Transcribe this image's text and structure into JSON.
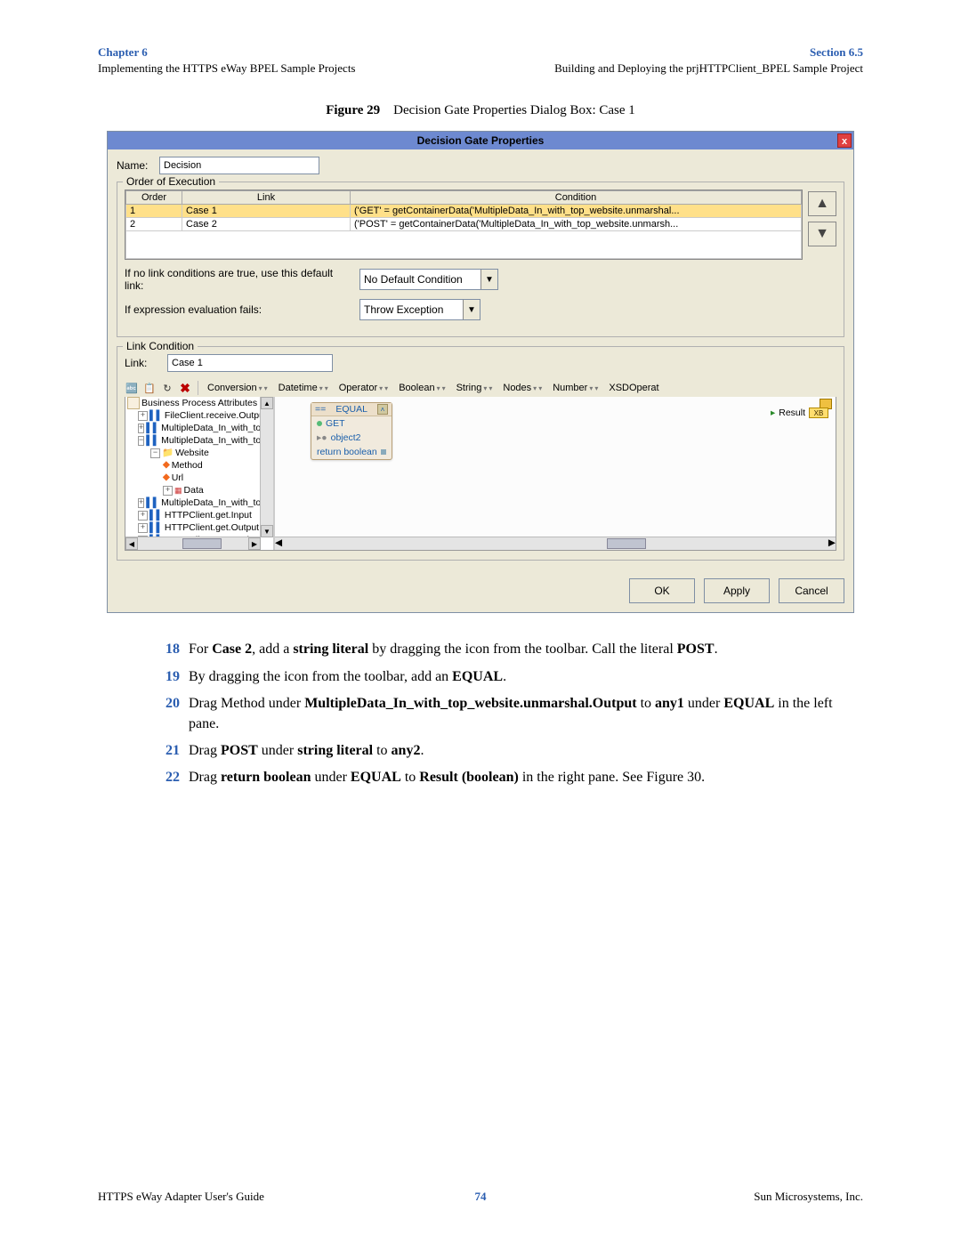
{
  "header": {
    "chapter": "Chapter 6",
    "left_sub": "Implementing the HTTPS eWay BPEL Sample Projects",
    "section": "Section 6.5",
    "right_sub": "Building and Deploying the prjHTTPClient_BPEL Sample Project"
  },
  "caption": {
    "fig": "Figure 29",
    "text": "Decision Gate Properties Dialog Box: Case 1"
  },
  "dialog": {
    "title": "Decision Gate Properties",
    "name_label": "Name:",
    "name_value": "Decision",
    "order_group": "Order of Execution",
    "cols": {
      "order": "Order",
      "link": "Link",
      "condition": "Condition"
    },
    "rows": [
      {
        "order": "1",
        "link": "Case 1",
        "condition": "('GET' = getContainerData('MultipleData_In_with_top_website.unmarshal..."
      },
      {
        "order": "2",
        "link": "Case 2",
        "condition": "('POST' = getContainerData('MultipleData_In_with_top_website.unmarsh..."
      }
    ],
    "default_link_label": "If no link conditions are true, use this default link:",
    "default_link_value": "No Default Condition",
    "fail_label": "If expression evaluation fails:",
    "fail_value": "Throw Exception",
    "link_cond_group": "Link Condition",
    "link_label": "Link:",
    "link_value": "Case 1",
    "toolbar": {
      "conversion": "Conversion",
      "datetime": "Datetime",
      "operator": "Operator",
      "boolean": "Boolean",
      "string": "String",
      "nodes": "Nodes",
      "number": "Number",
      "xsd": "XSDOperat"
    },
    "tree": {
      "root": "Business Process Attributes",
      "n1": "FileClient.receive.Output",
      "n2": "MultipleData_In_with_top_w",
      "n3": "MultipleData_In_with_top_w",
      "website": "Website",
      "method": "Method",
      "url": "Url",
      "data": "Data",
      "n4": "MultipleData_In_with_top_w",
      "n5": "HTTPClient.get.Input",
      "n6": "HTTPClient.get.Output",
      "n7": "HTTPClient.get.Fault"
    },
    "equal_box": {
      "title": "EQUAL",
      "row1": "GET",
      "row2": "object2",
      "row3": "return boolean"
    },
    "result_label": "Result",
    "result_box": "XB",
    "buttons": {
      "ok": "OK",
      "apply": "Apply",
      "cancel": "Cancel"
    }
  },
  "steps": {
    "s18a": "For ",
    "s18b": "Case 2",
    "s18c": ", add a ",
    "s18d": "string literal",
    "s18e": " by dragging the icon from the toolbar. Call the literal ",
    "s18f": "POST",
    "s18g": ".",
    "s19a": "By dragging the icon from the toolbar, add an ",
    "s19b": "EQUAL",
    "s19c": ".",
    "s20a": "Drag Method under ",
    "s20b": "MultipleData_In_with_top_website.unmarshal.Output",
    "s20c": " to ",
    "s20d": "any1",
    "s20e": " under ",
    "s20f": "EQUAL",
    "s20g": " in the left pane.",
    "s21a": "Drag ",
    "s21b": "POST",
    "s21c": " under ",
    "s21d": "string literal",
    "s21e": " to ",
    "s21f": "any2",
    "s21g": ".",
    "s22a": "Drag ",
    "s22b": "return boolean",
    "s22c": " under ",
    "s22d": "EQUAL",
    "s22e": " to ",
    "s22f": "Result (boolean)",
    "s22g": " in the right pane. See Figure 30.",
    "n18": "18",
    "n19": "19",
    "n20": "20",
    "n21": "21",
    "n22": "22"
  },
  "footer": {
    "left": "HTTPS eWay Adapter User's Guide",
    "page": "74",
    "right": "Sun Microsystems, Inc."
  }
}
